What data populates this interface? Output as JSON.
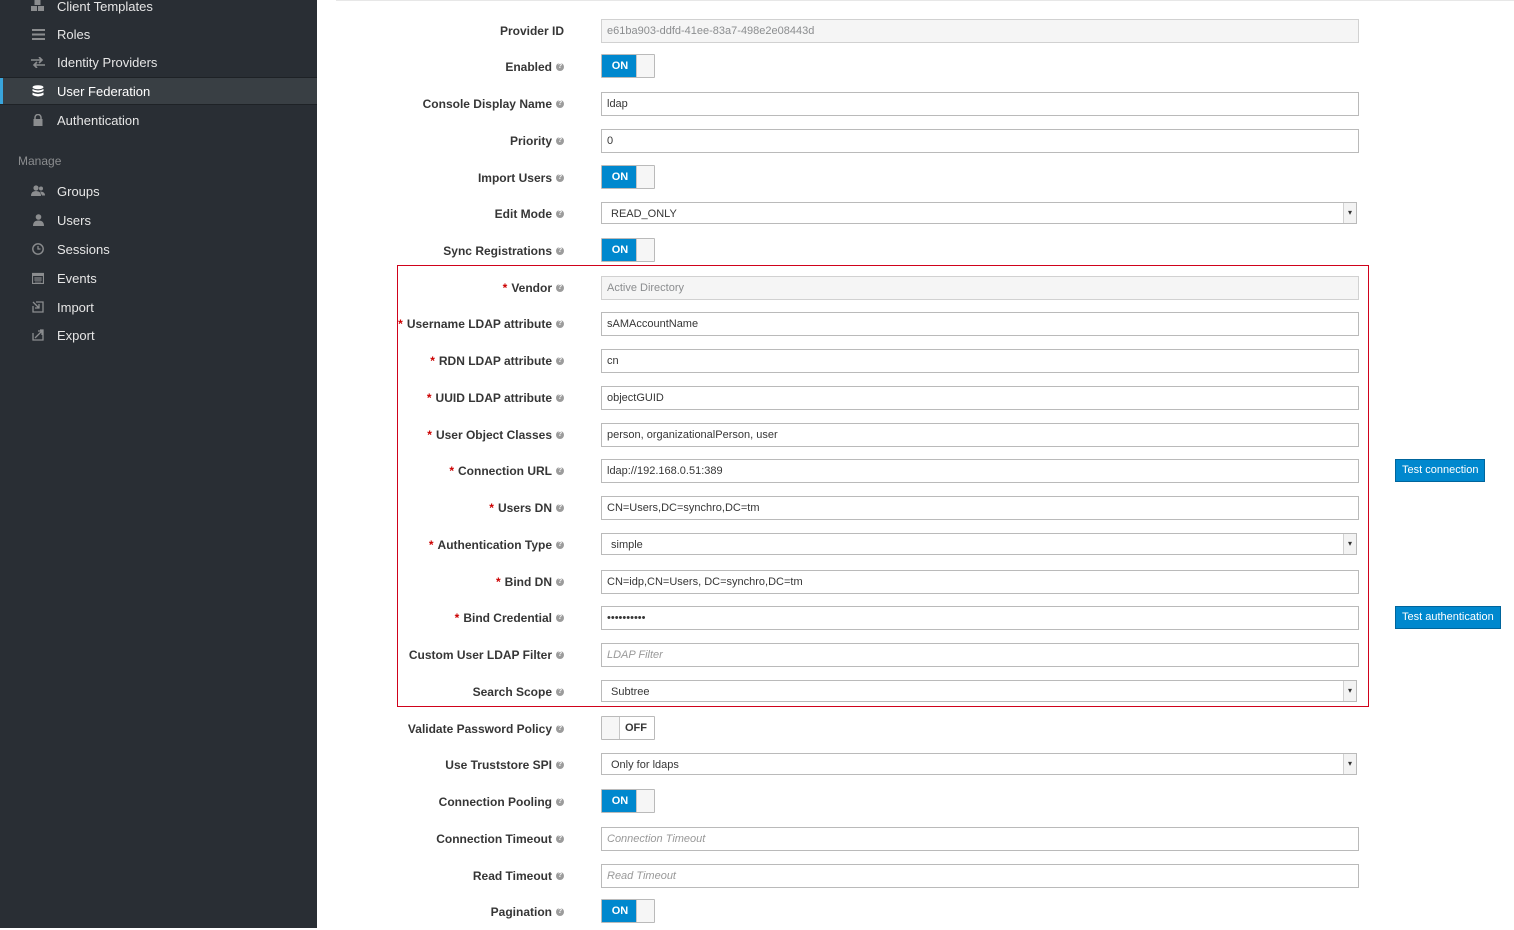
{
  "sidebar": {
    "items_top": [
      {
        "label": "Client Templates",
        "icon": "cubes-icon"
      },
      {
        "label": "Roles",
        "icon": "list-icon"
      },
      {
        "label": "Identity Providers",
        "icon": "exchange-icon"
      },
      {
        "label": "User Federation",
        "icon": "database-icon",
        "active": true
      },
      {
        "label": "Authentication",
        "icon": "lock-icon"
      }
    ],
    "manage_heading": "Manage",
    "items_manage": [
      {
        "label": "Groups",
        "icon": "users-icon"
      },
      {
        "label": "Users",
        "icon": "user-icon"
      },
      {
        "label": "Sessions",
        "icon": "clock-icon"
      },
      {
        "label": "Events",
        "icon": "calendar-icon"
      },
      {
        "label": "Import",
        "icon": "import-icon"
      },
      {
        "label": "Export",
        "icon": "export-icon"
      }
    ]
  },
  "form": {
    "provider_id": {
      "label": "Provider ID",
      "value": "e61ba903-ddfd-41ee-83a7-498e2e08443d"
    },
    "enabled": {
      "label": "Enabled",
      "state": "ON"
    },
    "console_display_name": {
      "label": "Console Display Name",
      "value": "ldap"
    },
    "priority": {
      "label": "Priority",
      "value": "0"
    },
    "import_users": {
      "label": "Import Users",
      "state": "ON"
    },
    "edit_mode": {
      "label": "Edit Mode",
      "value": "READ_ONLY"
    },
    "sync_registrations": {
      "label": "Sync Registrations",
      "state": "ON"
    },
    "vendor": {
      "label": "Vendor",
      "value": "Active Directory"
    },
    "username_ldap_attribute": {
      "label": "Username LDAP attribute",
      "value": "sAMAccountName"
    },
    "rdn_ldap_attribute": {
      "label": "RDN LDAP attribute",
      "value": "cn"
    },
    "uuid_ldap_attribute": {
      "label": "UUID LDAP attribute",
      "value": "objectGUID"
    },
    "user_object_classes": {
      "label": "User Object Classes",
      "value": "person, organizationalPerson, user"
    },
    "connection_url": {
      "label": "Connection URL",
      "value": "ldap://192.168.0.51:389",
      "button": "Test connection"
    },
    "users_dn": {
      "label": "Users DN",
      "value": "CN=Users,DC=synchro,DC=tm"
    },
    "authentication_type": {
      "label": "Authentication Type",
      "value": "simple"
    },
    "bind_dn": {
      "label": "Bind DN",
      "value": "CN=idp,CN=Users, DC=synchro,DC=tm"
    },
    "bind_credential": {
      "label": "Bind Credential",
      "value": "••••••••••",
      "button": "Test authentication"
    },
    "custom_user_ldap_filter": {
      "label": "Custom User LDAP Filter",
      "placeholder": "LDAP Filter"
    },
    "search_scope": {
      "label": "Search Scope",
      "value": "Subtree"
    },
    "validate_password_policy": {
      "label": "Validate Password Policy",
      "state": "OFF"
    },
    "use_truststore_spi": {
      "label": "Use Truststore SPI",
      "value": "Only for ldaps"
    },
    "connection_pooling": {
      "label": "Connection Pooling",
      "state": "ON"
    },
    "connection_timeout": {
      "label": "Connection Timeout",
      "placeholder": "Connection Timeout"
    },
    "read_timeout": {
      "label": "Read Timeout",
      "placeholder": "Read Timeout"
    },
    "pagination": {
      "label": "Pagination",
      "state": "ON"
    }
  },
  "colors": {
    "sidebar_bg": "#292e34",
    "accent": "#0088ce",
    "highlight_border": "#d0021b",
    "active_marker": "#39a5dc"
  }
}
